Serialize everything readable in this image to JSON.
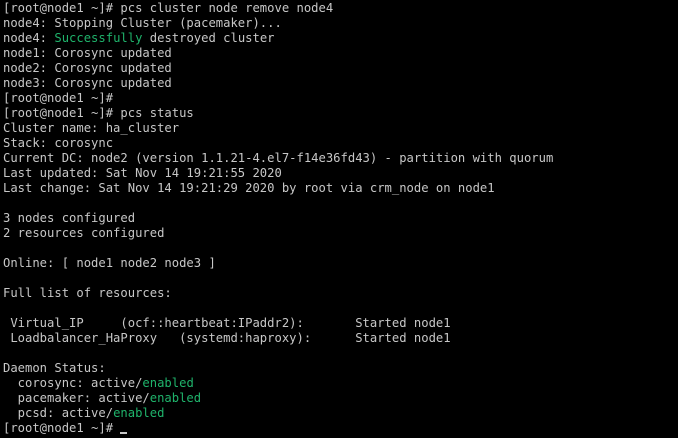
{
  "terminal": {
    "colors": {
      "background": "#000000",
      "foreground": "#c7c7c7",
      "highlight_green": "#1fb36b"
    },
    "lines": [
      {
        "segments": [
          {
            "text": "[root@node1 ~]# pcs cluster node remove node4"
          }
        ]
      },
      {
        "segments": [
          {
            "text": "node4: Stopping Cluster (pacemaker)..."
          }
        ]
      },
      {
        "segments": [
          {
            "text": "node4: "
          },
          {
            "text": "Successfully",
            "color": "green"
          },
          {
            "text": " destroyed cluster"
          }
        ]
      },
      {
        "segments": [
          {
            "text": "node1: Corosync updated"
          }
        ]
      },
      {
        "segments": [
          {
            "text": "node2: Corosync updated"
          }
        ]
      },
      {
        "segments": [
          {
            "text": "node3: Corosync updated"
          }
        ]
      },
      {
        "segments": [
          {
            "text": "[root@node1 ~]#"
          }
        ]
      },
      {
        "segments": [
          {
            "text": "[root@node1 ~]# pcs status"
          }
        ]
      },
      {
        "segments": [
          {
            "text": "Cluster name: ha_cluster"
          }
        ]
      },
      {
        "segments": [
          {
            "text": "Stack: corosync"
          }
        ]
      },
      {
        "segments": [
          {
            "text": "Current DC: node2 (version 1.1.21-4.el7-f14e36fd43) - partition with quorum"
          }
        ]
      },
      {
        "segments": [
          {
            "text": "Last updated: Sat Nov 14 19:21:55 2020"
          }
        ]
      },
      {
        "segments": [
          {
            "text": "Last change: Sat Nov 14 19:21:29 2020 by root via crm_node on node1"
          }
        ]
      },
      {
        "segments": [
          {
            "text": ""
          }
        ]
      },
      {
        "segments": [
          {
            "text": "3 nodes configured"
          }
        ]
      },
      {
        "segments": [
          {
            "text": "2 resources configured"
          }
        ]
      },
      {
        "segments": [
          {
            "text": ""
          }
        ]
      },
      {
        "segments": [
          {
            "text": "Online: [ node1 node2 node3 ]"
          }
        ]
      },
      {
        "segments": [
          {
            "text": ""
          }
        ]
      },
      {
        "segments": [
          {
            "text": "Full list of resources:"
          }
        ]
      },
      {
        "segments": [
          {
            "text": ""
          }
        ]
      },
      {
        "segments": [
          {
            "text": " Virtual_IP     (ocf::heartbeat:IPaddr2):       Started node1"
          }
        ]
      },
      {
        "segments": [
          {
            "text": " Loadbalancer_HaProxy   (systemd:haproxy):      Started node1"
          }
        ]
      },
      {
        "segments": [
          {
            "text": ""
          }
        ]
      },
      {
        "segments": [
          {
            "text": "Daemon Status:"
          }
        ]
      },
      {
        "segments": [
          {
            "text": "  corosync: active/"
          },
          {
            "text": "enabled",
            "color": "green"
          }
        ]
      },
      {
        "segments": [
          {
            "text": "  pacemaker: active/"
          },
          {
            "text": "enabled",
            "color": "green"
          }
        ]
      },
      {
        "segments": [
          {
            "text": "  pcsd: active/"
          },
          {
            "text": "enabled",
            "color": "green"
          }
        ]
      },
      {
        "segments": [
          {
            "text": "[root@node1 ~]# "
          }
        ],
        "cursor": true
      }
    ]
  }
}
